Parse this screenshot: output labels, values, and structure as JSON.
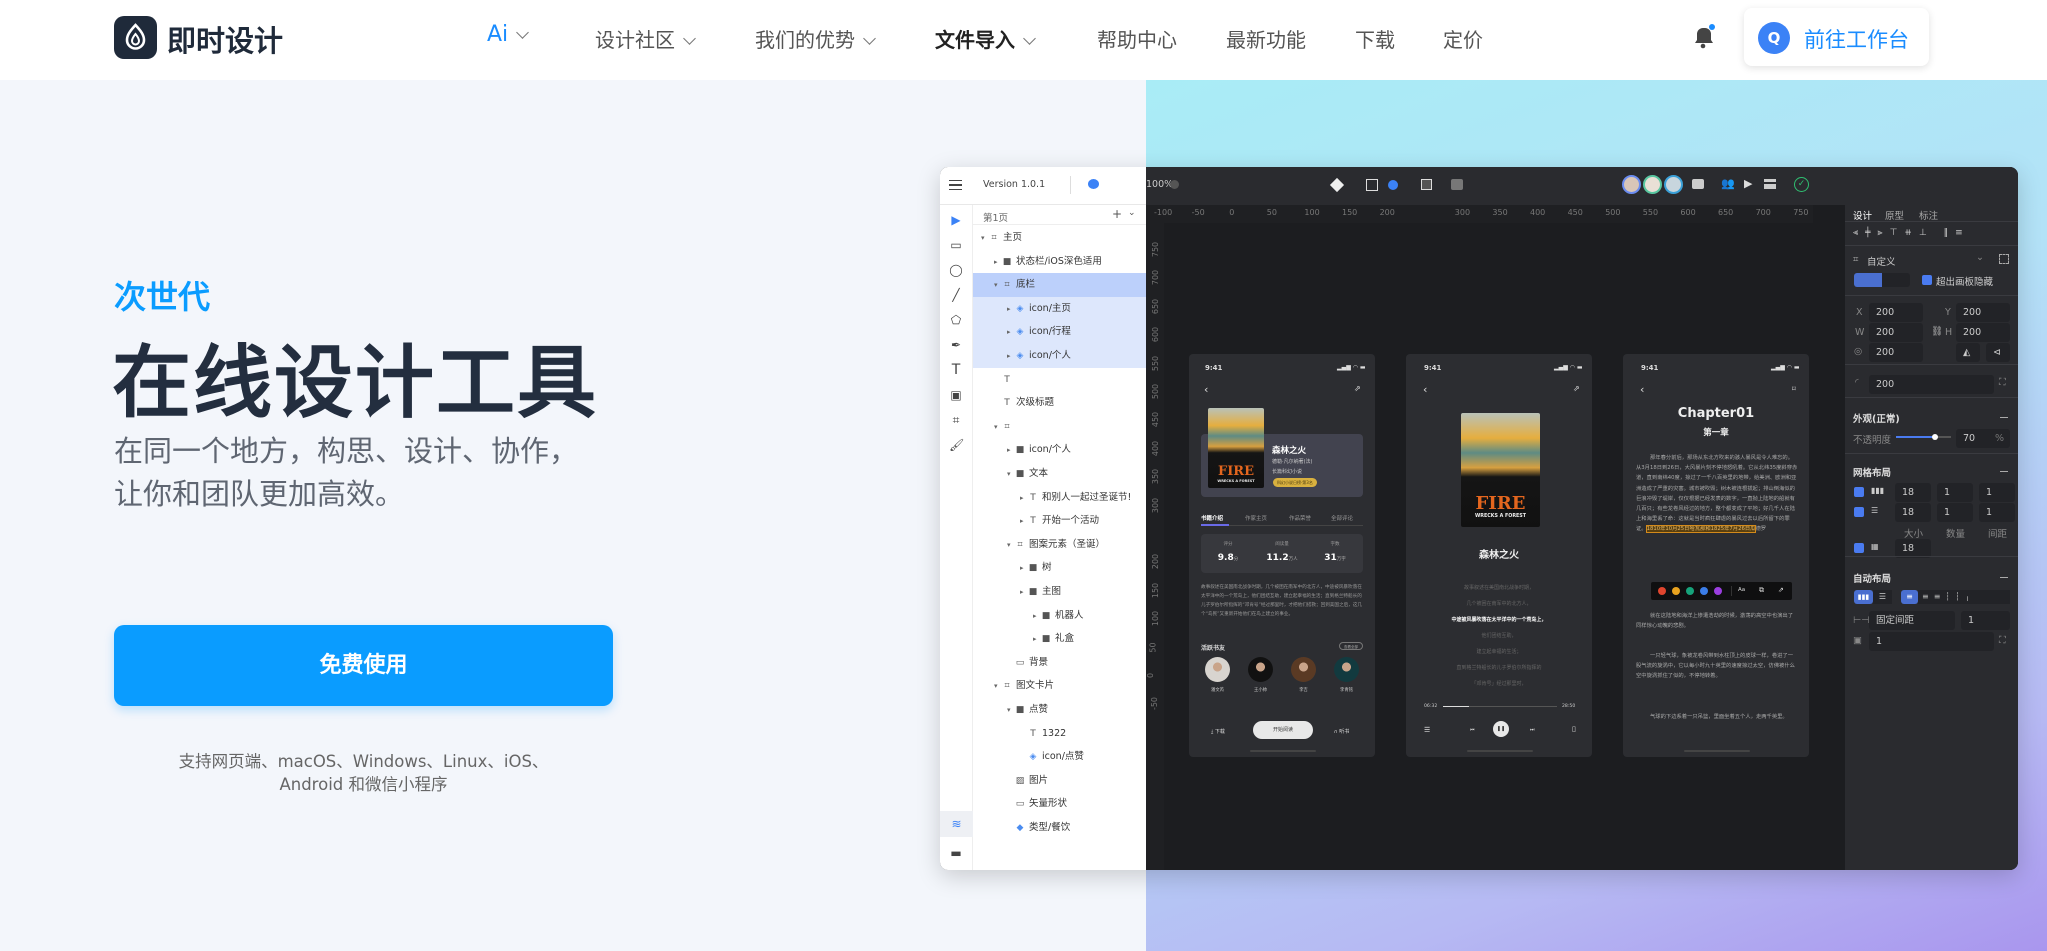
{
  "header": {
    "logo_text": "即时设计",
    "nav": [
      {
        "label": "Ai",
        "chevron": true,
        "active": true
      },
      {
        "label": "设计社区",
        "chevron": true
      },
      {
        "label": "我们的优势",
        "chevron": true
      },
      {
        "label": "文件导入",
        "chevron": true,
        "bold": true
      },
      {
        "label": "帮助中心"
      },
      {
        "label": "最新功能"
      },
      {
        "label": "下载"
      },
      {
        "label": "定价"
      }
    ],
    "bell_icon": "bell-icon",
    "workspace_avatar": "Q",
    "workspace_label": "前往工作台"
  },
  "hero": {
    "kicker": "次世代",
    "title": "在线设计工具",
    "subtitle_line1": "在同一个地方，构思、设计、协作，",
    "subtitle_line2": "让你和团队更加高效。",
    "cta": "免费使用",
    "platforms_line1": "支持网页端、macOS、Windows、Linux、iOS、",
    "platforms_line2": "Android 和微信小程序"
  },
  "colors": {
    "accent": "#0a9cff",
    "title": "#232e3f",
    "selection": "#bcd0fb"
  },
  "app": {
    "version": "Version 1.0.1",
    "zoom": "100%",
    "page": "第1页",
    "layers": [
      {
        "label": "主页",
        "icon": "frame",
        "level": 0,
        "arrow": "down"
      },
      {
        "label": "状态栏/iOS深色适用",
        "icon": "folder",
        "level": 1,
        "arrow": "right"
      },
      {
        "label": "底栏",
        "icon": "frame",
        "level": 1,
        "arrow": "down",
        "state": "sel"
      },
      {
        "label": "icon/主页",
        "icon": "component",
        "level": 2,
        "arrow": "right",
        "state": "sub"
      },
      {
        "label": "icon/行程",
        "icon": "component",
        "level": 2,
        "arrow": "right",
        "state": "sub"
      },
      {
        "label": "icon/个人",
        "icon": "component",
        "level": 2,
        "arrow": "right",
        "state": "sub"
      },
      {
        "label": "",
        "icon": "text",
        "level": 1
      },
      {
        "label": "次级标题",
        "icon": "text",
        "level": 1
      },
      {
        "label": "",
        "icon": "frame",
        "level": 1,
        "arrow": "down"
      },
      {
        "label": "icon/个人",
        "icon": "folder",
        "level": 2,
        "arrow": "right"
      },
      {
        "label": "文本",
        "icon": "folder",
        "level": 2,
        "arrow": "down"
      },
      {
        "label": "和别人一起过圣诞节!",
        "icon": "text",
        "level": 3,
        "arrow": "right"
      },
      {
        "label": "开始一个活动",
        "icon": "text",
        "level": 3,
        "arrow": "right"
      },
      {
        "label": "图案元素（圣诞）",
        "icon": "frame",
        "level": 2,
        "arrow": "down"
      },
      {
        "label": "树",
        "icon": "folder",
        "level": 3,
        "arrow": "right"
      },
      {
        "label": "主图",
        "icon": "folder",
        "level": 3,
        "arrow": "right"
      },
      {
        "label": "机器人",
        "icon": "folder",
        "level": 4,
        "arrow": "right"
      },
      {
        "label": "礼盒",
        "icon": "folder",
        "level": 4,
        "arrow": "right"
      },
      {
        "label": "背景",
        "icon": "rect",
        "level": 2
      },
      {
        "label": "图文卡片",
        "icon": "frame",
        "level": 1,
        "arrow": "down"
      },
      {
        "label": "点赞",
        "icon": "folder",
        "level": 2,
        "arrow": "down"
      },
      {
        "label": "1322",
        "icon": "text",
        "level": 3
      },
      {
        "label": "icon/点赞",
        "icon": "component",
        "level": 3
      },
      {
        "label": "图片",
        "icon": "image",
        "level": 2
      },
      {
        "label": "矢量形状",
        "icon": "rect",
        "level": 2
      },
      {
        "label": "类型/餐饮",
        "icon": "component-filled",
        "level": 2
      }
    ],
    "ruler_h": [
      "-100",
      "-50",
      "0",
      "50",
      "100",
      "150",
      "200",
      "",
      "300",
      "350",
      "400",
      "450",
      "500",
      "550",
      "600",
      "650",
      "700",
      "750"
    ],
    "ruler_v": [
      "750",
      "700",
      "650",
      "600",
      "550",
      "500",
      "450",
      "400",
      "350",
      "300",
      "",
      "200",
      "150",
      "100",
      "50",
      "0",
      "-50"
    ],
    "right_panel": {
      "tabs": [
        "设计",
        "原型",
        "标注"
      ],
      "frame_preset": "自定义",
      "clip_label": "超出画板隐藏",
      "x": "200",
      "y": "200",
      "w": "200",
      "h": "200",
      "rotation": "200",
      "radius": "200",
      "appearance": "外观(正常)",
      "opacity_label": "不透明度",
      "opacity": "70",
      "opacity_unit": "%",
      "opacity_value": 0.7,
      "grid_title": "网格布局",
      "grid_rows": [
        [
          "18",
          "1",
          "1"
        ],
        [
          "18",
          "1",
          "1"
        ],
        [
          "18"
        ]
      ],
      "grid_labels": [
        "大小",
        "数量",
        "间距"
      ],
      "auto_title": "自动布局",
      "spacing_mode": "固定间距",
      "spacing": "1",
      "padding": "1",
      "labels": {
        "x": "X",
        "y": "Y",
        "w": "W",
        "h": "H"
      }
    },
    "phone1": {
      "time": "9:41",
      "title": "森林之火",
      "author": "德勒·凡尔纳著(法)",
      "genre": "长篇科幻小说",
      "badge": "科幻小说日榜·第3名",
      "tabs": [
        "书籍介绍",
        "作家主页",
        "作品荣誉",
        "全部评论"
      ],
      "stats": [
        {
          "label": "评分",
          "value": "9.8",
          "unit": "分"
        },
        {
          "label": "阅读量",
          "value": "11.2",
          "unit": "万人"
        },
        {
          "label": "字数",
          "value": "31",
          "unit": "万字"
        }
      ],
      "desc": "故事叙述在美国南北战争时期，几个被困在南军中的北方人，中途被风暴吹落在太平洋中的一个荒岛上，他们团结互助，建立起幸福的生活；直到格兰特船长的儿子罗伯尔所指挥的“邓肯号”经过那里时，才把他们搭救；回到美国之后，这几个“岛民”又重新开始他们在岛上建立的事业。",
      "friends_title": "活跃书友",
      "view_all": "查看全部",
      "friends": [
        "潘文芮",
        "王小帅",
        "李吉",
        "李青铭"
      ],
      "download": "下载",
      "read": "开始阅读",
      "listen": "听书",
      "cover_title": "FIRE",
      "cover_sub": "WRECKS A FOREST"
    },
    "phone2": {
      "time": "9:41",
      "title": "森林之火",
      "lines": [
        "故事叙述在美国南北战争时期，",
        "几个被困在南军中的北方人，",
        "中途被风暴吹落在太平洋中的一个荒岛上，",
        "他们团结互助，",
        "建立起幸福的生活；",
        "直到格兰特船长的儿子罗伯尔所指挥的",
        "「邓肯号」经过那里时，"
      ],
      "elapsed": "06:32",
      "total": "28:50",
      "progress": 0.23
    },
    "phone3": {
      "time": "9:41",
      "chapter": "Chapter01",
      "chapter_cn": "第一章",
      "p1": "那年春分前后，那场从东北方吹来的骇人暴风是令人难忘的。从3月18日到26日，大风暴片刻不停地怒吼着。它从北纬35度斜穿赤道，直到南纬40度，掠过了一千八百英里的地带，给美洲、欧洲和亚洲造成了严重的灾害。城市被吹毁；树木被连根拔起；排山倒海似的巨浪冲毁了堤岸，仅仅根据已经发表的数字，一直抛上陆地的船就有几百只；有些龙卷风经过的地方，整个都变成了平地；好几千人在陆上和海里丢了命：这就是当时疯狂肆虐的暴风过去以后所留下的罪证。",
      "highlight": "1810年10月25日哈瓦那和1825年7月26日瓜",
      "p1b": "德罗",
      "p2": "就在这陆地和海洋上惨遭浩劫的时候，激荡的高空中也演出了同样惊心动魄的悲剧。",
      "p3": "一只轻气球，象被龙卷风带到水柱顶上的皮球一样，卷进了一股气流的旋涡中，它以每小时九十英里的速度掠过太空，仿佛被什么空中旋涡抓住了似的，不停地转着。",
      "p4": "气球的下边系着一只吊篮，里面坐着五个人，走两千英里。",
      "toolbar_colors": [
        "#e0452e",
        "#e8a21f",
        "#16a37b",
        "#3b7de8",
        "#9b3ee0"
      ],
      "toolbar_font": "Aa"
    }
  }
}
